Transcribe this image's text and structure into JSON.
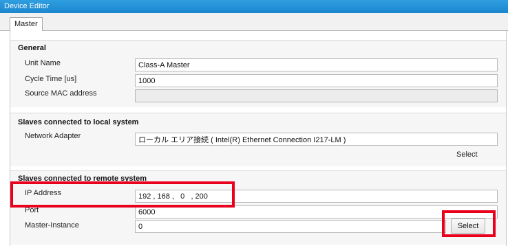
{
  "window": {
    "title": "Device Editor"
  },
  "tabs": [
    {
      "label": "Master"
    }
  ],
  "general": {
    "title": "General",
    "unit_name_label": "Unit Name",
    "unit_name_value": "Class-A Master",
    "cycle_time_label": "Cycle Time [us]",
    "cycle_time_value": "1000",
    "mac_label": "Source MAC address",
    "mac_value": ""
  },
  "local": {
    "title": "Slaves connected to local system",
    "adapter_label": "Network Adapter",
    "adapter_value": "ローカル エリア接続 ( Intel(R) Ethernet Connection I217-LM )",
    "select_label": "Select"
  },
  "remote": {
    "title": "Slaves connected to remote system",
    "ip_label": "IP Address",
    "ip_value": "192 , 168 ,   0   , 200",
    "port_label": "Port",
    "port_value": "6000",
    "instance_label": "Master-Instance",
    "instance_value": "0",
    "select_label": "Select"
  },
  "colors": {
    "titlebar": "#1b86cf",
    "highlight": "#e8001c"
  }
}
